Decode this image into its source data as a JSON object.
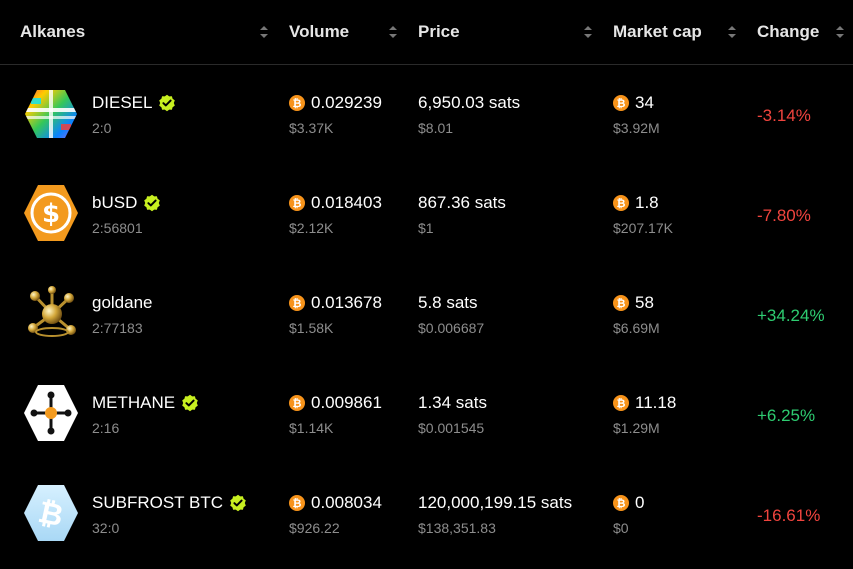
{
  "header": {
    "alkanes": "Alkanes",
    "volume": "Volume",
    "price": "Price",
    "market_cap": "Market cap",
    "change": "Change"
  },
  "colors": {
    "negative": "#f0443e",
    "positive": "#2ecc71",
    "btc": "#f7931a",
    "verified": "#c8f020"
  },
  "rows": [
    {
      "name": "DIESEL",
      "id": "2:0",
      "verified": true,
      "logo": "diesel-rainbow-hexagon-icon",
      "volume_btc": "0.029239",
      "volume_usd": "$3.37K",
      "price_sats": "6,950.03 sats",
      "price_usd": "$8.01",
      "mcap_btc": "34",
      "mcap_usd": "$3.92M",
      "change": "-3.14%",
      "direction": "neg"
    },
    {
      "name": "bUSD",
      "id": "2:56801",
      "verified": true,
      "logo": "dollar-coin-icon",
      "volume_btc": "0.018403",
      "volume_usd": "$2.12K",
      "price_sats": "867.36 sats",
      "price_usd": "$1",
      "mcap_btc": "1.8",
      "mcap_usd": "$207.17K",
      "change": "-7.80%",
      "direction": "neg"
    },
    {
      "name": "goldane",
      "id": "2:77183",
      "verified": false,
      "logo": "gold-molecule-icon",
      "volume_btc": "0.013678",
      "volume_usd": "$1.58K",
      "price_sats": "5.8 sats",
      "price_usd": "$0.006687",
      "mcap_btc": "58",
      "mcap_usd": "$6.69M",
      "change": "+34.24%",
      "direction": "pos"
    },
    {
      "name": "METHANE",
      "id": "2:16",
      "verified": true,
      "logo": "methane-molecule-icon",
      "volume_btc": "0.009861",
      "volume_usd": "$1.14K",
      "price_sats": "1.34 sats",
      "price_usd": "$0.001545",
      "mcap_btc": "11.18",
      "mcap_usd": "$1.29M",
      "change": "+6.25%",
      "direction": "pos"
    },
    {
      "name": "SUBFROST BTC",
      "id": "32:0",
      "verified": true,
      "logo": "frost-bitcoin-icon",
      "volume_btc": "0.008034",
      "volume_usd": "$926.22",
      "price_sats": "120,000,199.15 sats",
      "price_usd": "$138,351.83",
      "mcap_btc": "0",
      "mcap_usd": "$0",
      "change": "-16.61%",
      "direction": "neg"
    }
  ]
}
